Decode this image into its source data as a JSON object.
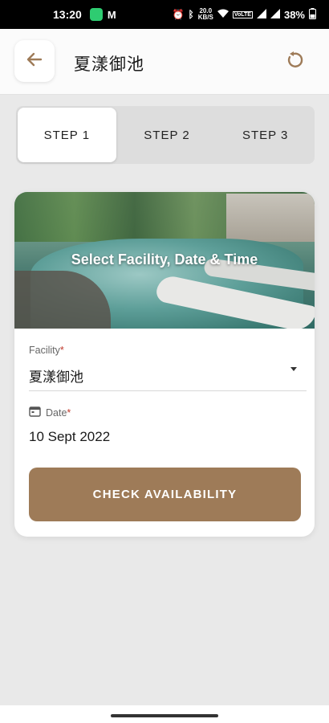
{
  "status_bar": {
    "time": "13:20",
    "data_speed": "20.0",
    "data_unit": "KB/S",
    "network": "VoLTE",
    "battery": "38%",
    "icons": [
      "chat-app-icon",
      "gmail-icon",
      "alarm-icon",
      "bluetooth-icon",
      "wifi-icon",
      "signal-icon",
      "battery-icon"
    ]
  },
  "app_bar": {
    "title": "夏漾御池",
    "back_icon": "arrow-left-icon",
    "refresh_icon": "refresh-icon"
  },
  "stepper": {
    "steps": [
      {
        "label": "STEP 1",
        "active": true
      },
      {
        "label": "STEP 2",
        "active": false
      },
      {
        "label": "STEP 3",
        "active": false
      }
    ]
  },
  "card": {
    "hero_title": "Select Facility, Date & Time",
    "facility": {
      "label": "Facility",
      "required_mark": "*",
      "value": "夏漾御池"
    },
    "date": {
      "label": "Date",
      "required_mark": "*",
      "value": "10 Sept 2022",
      "icon": "calendar-icon"
    },
    "button_label": "CHECK AVAILABILITY"
  },
  "colors": {
    "accent": "#9e7b58",
    "background": "#e9e9e9",
    "required": "#c0392b"
  }
}
